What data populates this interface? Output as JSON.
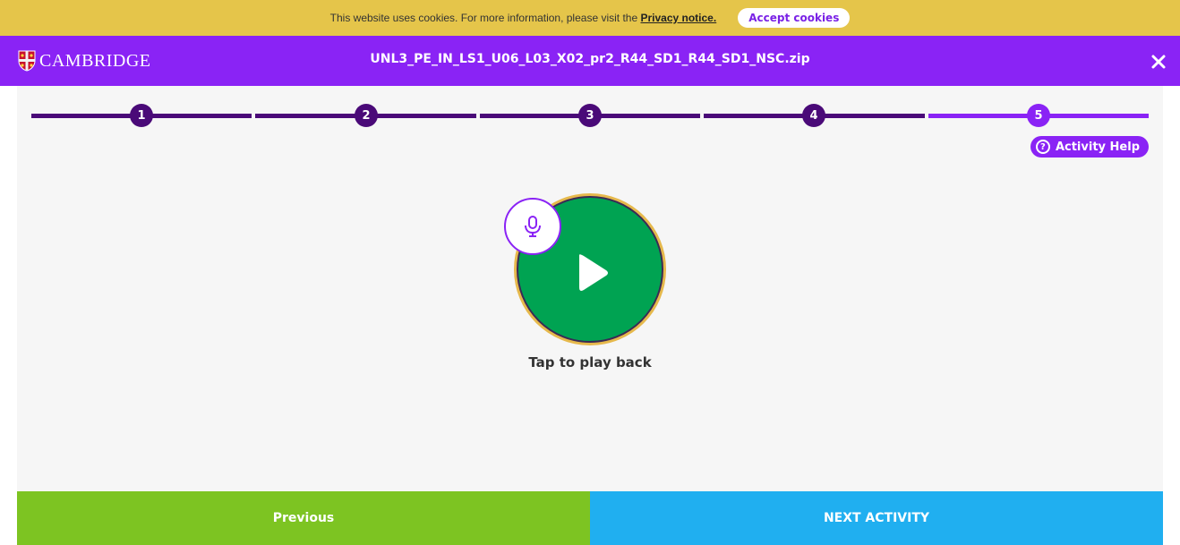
{
  "cookie": {
    "text": "This website uses cookies. For more information, please visit the",
    "link": "Privacy notice.",
    "accept": "Accept cookies"
  },
  "header": {
    "brand": "CAMBRIDGE",
    "title": "UNL3_PE_IN_LS1_U06_L03_X02_pr2_R44_SD1_R44_SD1_NSC.zip"
  },
  "steps": [
    {
      "label": "1",
      "state": "done"
    },
    {
      "label": "2",
      "state": "done"
    },
    {
      "label": "3",
      "state": "done"
    },
    {
      "label": "4",
      "state": "done"
    },
    {
      "label": "5",
      "state": "current"
    }
  ],
  "activity": {
    "help": "Activity Help",
    "playback_label": "Tap to play back"
  },
  "footer": {
    "previous": "Previous",
    "next": "NEXT ACTIVITY"
  },
  "colors": {
    "cookie_bg": "#e5c54a",
    "brand_purple": "#8a23f5",
    "step_done": "#4a0a78",
    "play_green": "#00a352",
    "previous_green": "#7dc422",
    "next_blue": "#20aff0"
  }
}
